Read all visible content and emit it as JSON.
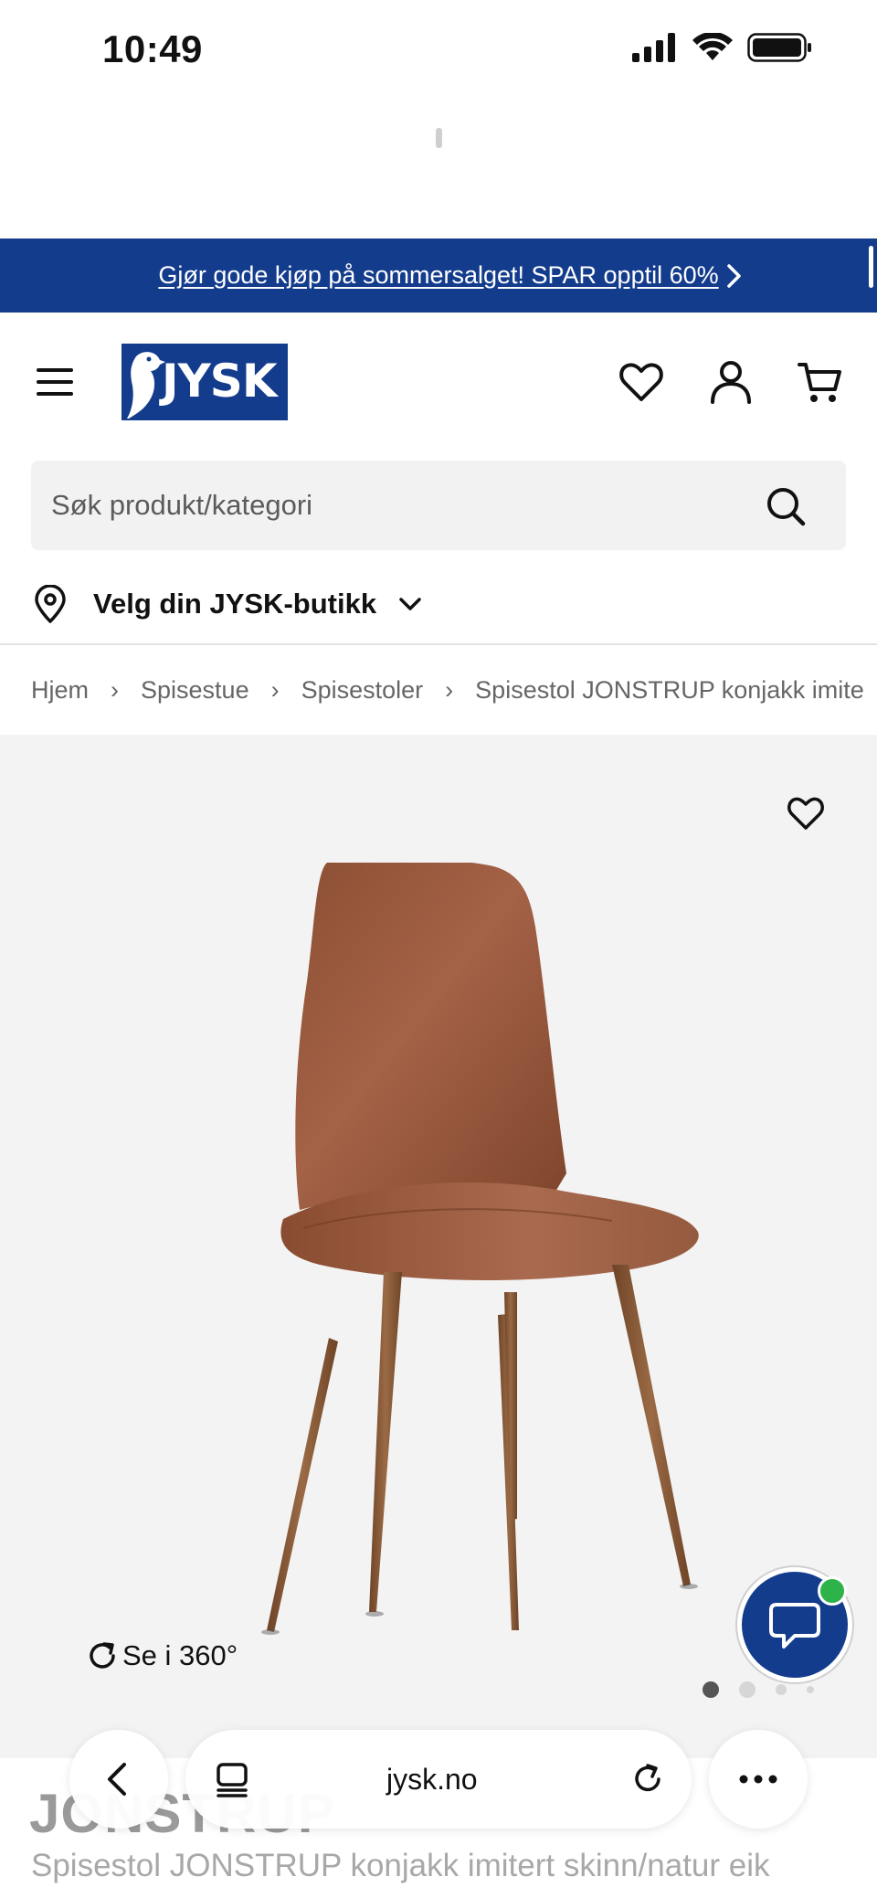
{
  "status_bar": {
    "time": "10:49"
  },
  "promo": {
    "text": "Gjør gode kjøp på sommersalget! SPAR opptil 60%"
  },
  "header": {
    "logo_text": "JYSK"
  },
  "search": {
    "placeholder": "Søk produkt/kategori"
  },
  "store_selector": {
    "label": "Velg din JYSK-butikk"
  },
  "breadcrumb": {
    "items": [
      "Hjem",
      "Spisestue",
      "Spisestoler",
      "Spisestol JONSTRUP konjakk imite"
    ]
  },
  "gallery": {
    "view360_label": "Se i 360°",
    "image_count": 4,
    "active_index": 0
  },
  "product": {
    "name": "JONSTRUP",
    "subtitle": "Spisestol JONSTRUP konjakk imitert skinn/natur eik"
  },
  "browser": {
    "url": "jysk.no"
  },
  "colors": {
    "brand_blue": "#143c8c",
    "chat_online": "#2db34a",
    "gallery_bg": "#f3f3f3"
  },
  "icons": [
    "signal-icon",
    "wifi-icon",
    "battery-icon",
    "chevron-right-icon",
    "menu-icon",
    "heart-icon",
    "user-icon",
    "cart-icon",
    "search-icon",
    "location-pin-icon",
    "chevron-down-icon",
    "rotate-360-icon",
    "chat-icon",
    "back-icon",
    "tabs-icon",
    "reload-icon",
    "more-icon"
  ]
}
